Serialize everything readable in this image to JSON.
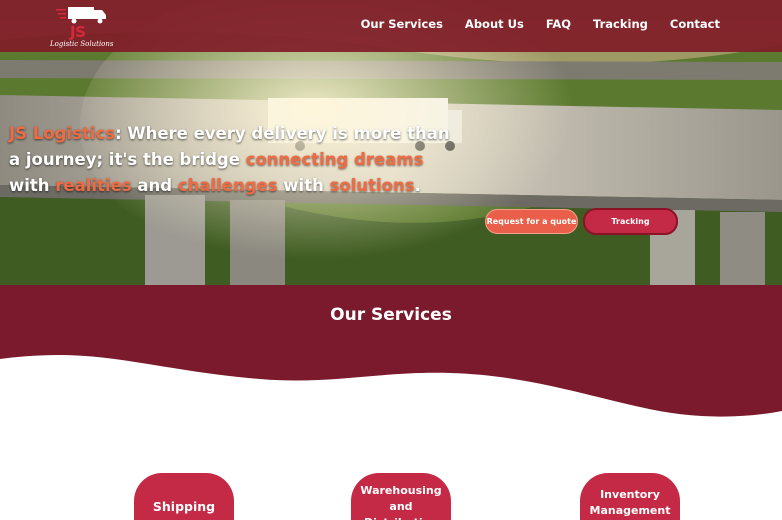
{
  "brand": {
    "logo_text": "JS",
    "logo_subtitle": "Logistic Solutions"
  },
  "nav": {
    "items": [
      {
        "label": "Our Services"
      },
      {
        "label": "About Us"
      },
      {
        "label": "FAQ"
      },
      {
        "label": "Tracking"
      },
      {
        "label": "Contact"
      }
    ]
  },
  "hero": {
    "brand_name": "JS Logistics",
    "part1": ": Where every delivery is more than a journey; it's the bridge ",
    "accent1": "connecting dreams",
    "part2": " with ",
    "accent2": "realities",
    "part3": " and ",
    "accent3": "challenges",
    "part4": " with ",
    "accent4": "solutions",
    "part5": ".",
    "quote_button": "Request for a quote",
    "tracking_button": "Tracking"
  },
  "services": {
    "title": "Our Services",
    "cards": [
      {
        "label": "Shipping"
      },
      {
        "label": "Warehousing and Distribution"
      },
      {
        "label": "Inventory Management"
      }
    ]
  },
  "colors": {
    "brand_maroon": "#7b1a2d",
    "accent_orange": "#f06a42",
    "button_red": "#c42a45"
  }
}
